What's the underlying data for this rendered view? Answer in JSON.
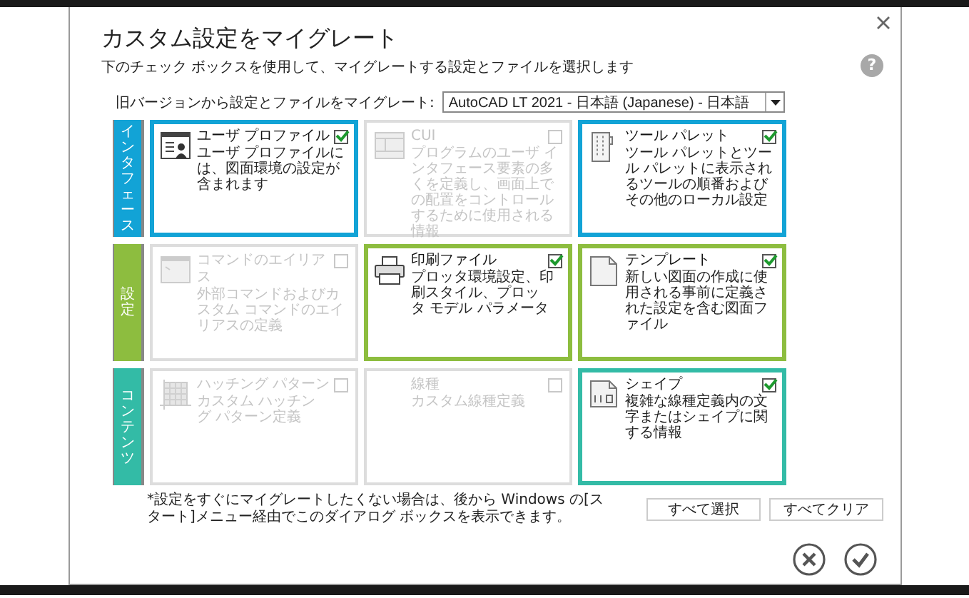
{
  "dialog": {
    "title": "カスタム設定をマイグレート",
    "subtitle": "下のチェック ボックスを使用して、マイグレートする設定とファイルを選択します",
    "help": "?",
    "source_label": "旧バージョンから設定とファイルをマイグレート:",
    "source_value": "AutoCAD LT 2021 - 日本語 (Japanese) - 日本語"
  },
  "groups": [
    {
      "label": "インタフェース",
      "color": "#12a3d6",
      "items": [
        {
          "kind": "profile",
          "title": "ユーザ プロファイル",
          "description": "ユーザ プロファイルには、図面環境の設定が含まれます",
          "checked": true,
          "disabled": false
        },
        {
          "kind": "cui",
          "title": "CUI",
          "description": "プログラムのユーザ インタフェース要素の多くを定義し、画面上での配置をコントロールするために使用される情報",
          "checked": false,
          "disabled": true
        },
        {
          "kind": "palette",
          "title": "ツール パレット",
          "description": "ツール パレットとツール パレットに表示されるツールの順番およびその他のローカル設定",
          "checked": true,
          "disabled": false
        }
      ]
    },
    {
      "label": "設定",
      "color": "#8dbd3f",
      "items": [
        {
          "kind": "alias",
          "title": "コマンドのエイリアス",
          "description": "外部コマンドおよびカスタム コマンドのエイリアスの定義",
          "checked": false,
          "disabled": true
        },
        {
          "kind": "printer",
          "title": "印刷ファイル",
          "description": "プロッタ環境設定、印刷スタイル、プロッタ モデル パラメータ",
          "checked": true,
          "disabled": false
        },
        {
          "kind": "template",
          "title": "テンプレート",
          "description": "新しい図面の作成に使用される事前に定義された設定を含む図面ファイル",
          "checked": true,
          "disabled": false
        }
      ]
    },
    {
      "label": "コンテンツ",
      "color": "#33bba6",
      "items": [
        {
          "kind": "hatch",
          "title": "ハッチング パターン",
          "description": "カスタム ハッチング パターン定義",
          "checked": false,
          "disabled": true
        },
        {
          "kind": "linetype",
          "title": "線種",
          "description": "カスタム線種定義",
          "checked": false,
          "disabled": true
        },
        {
          "kind": "shape",
          "title": "シェイプ",
          "description": "複雑な線種定義内の文字またはシェイプに関する情報",
          "checked": true,
          "disabled": false
        }
      ]
    }
  ],
  "footnote": "*設定をすぐにマイグレートしたくない場合は、後から Windows の[スタート]メニュー経由でこのダイアログ ボックスを表示できます。",
  "buttons": [
    "すべて選択",
    "すべてクリア"
  ]
}
